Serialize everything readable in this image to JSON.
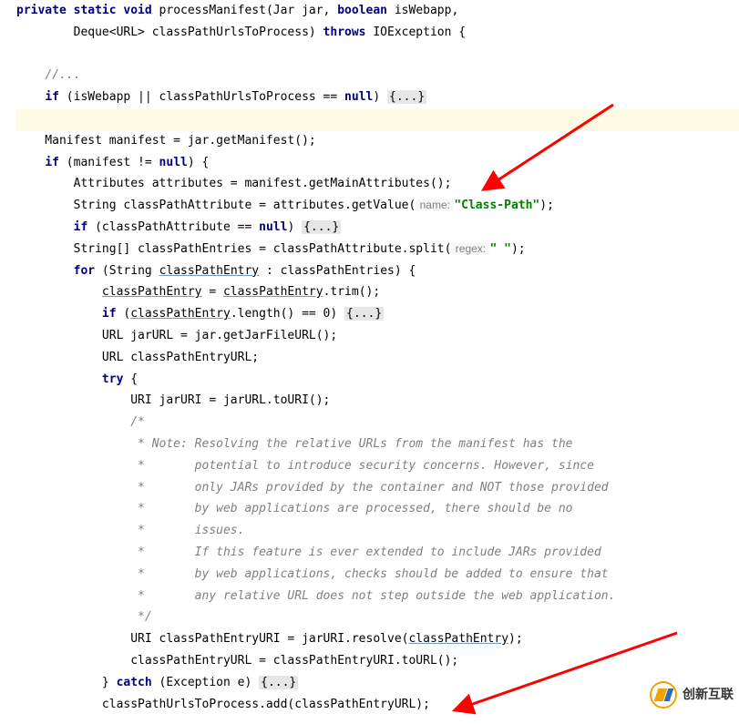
{
  "code": {
    "line1": "private static void processManifest(Jar jar, boolean isWebapp,",
    "line2": "        Deque<URL> classPathUrlsToProcess) throws IOException {",
    "line3": "",
    "line4": "    //...",
    "line5": "    if (isWebapp || classPathUrlsToProcess == null) {...}",
    "line6": "",
    "line7": "    Manifest manifest = jar.getManifest();",
    "line8": "    if (manifest != null) {",
    "line9": "        Attributes attributes = manifest.getMainAttributes();",
    "line10a": "        String classPathAttribute = attributes.getValue(",
    "line10_hint": " name: ",
    "line10_str": "\"Class-Path\"",
    "line10_end": ");",
    "line11": "        if (classPathAttribute == null) {...}",
    "line12a": "        String[] classPathEntries = classPathAttribute.split(",
    "line12_hint": " regex: ",
    "line12_str": "\" \"",
    "line12_end": ");",
    "line13": "        for (String classPathEntry : classPathEntries) {",
    "line14": "            classPathEntry = classPathEntry.trim();",
    "line15": "            if (classPathEntry.length() == 0) {...}",
    "line16": "            URL jarURL = jar.getJarFileURL();",
    "line17": "            URL classPathEntryURL;",
    "line18": "            try {",
    "line19": "                URI jarURI = jarURL.toURI();",
    "line20": "                /*",
    "line21": "                 * Note: Resolving the relative URLs from the manifest has the",
    "line22": "                 *       potential to introduce security concerns. However, since",
    "line23": "                 *       only JARs provided by the container and NOT those provided",
    "line24": "                 *       by web applications are processed, there should be no",
    "line25": "                 *       issues.",
    "line26": "                 *       If this feature is ever extended to include JARs provided",
    "line27": "                 *       by web applications, checks should be added to ensure that",
    "line28": "                 *       any relative URL does not step outside the web application.",
    "line29": "                 */",
    "line30": "                URI classPathEntryURI = jarURI.resolve(classPathEntry);",
    "line31": "                classPathEntryURL = classPathEntryURI.toURL();",
    "line32": "            } catch (Exception e) {...}",
    "line33": "            classPathUrlsToProcess.add(classPathEntryURL);"
  },
  "fold": "{...}",
  "watermark": {
    "text": "创新互联"
  }
}
